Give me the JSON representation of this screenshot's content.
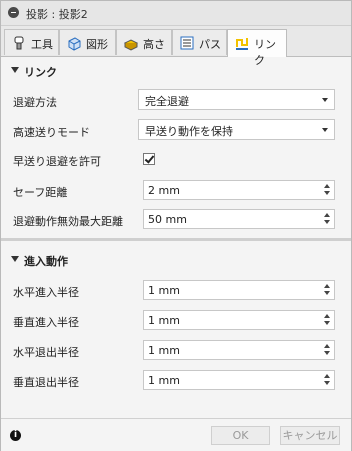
{
  "window": {
    "title": "投影 : 投影2"
  },
  "tabs": [
    {
      "label": "工具",
      "icon": "tool-icon"
    },
    {
      "label": "図形",
      "icon": "geometry-icon"
    },
    {
      "label": "高さ",
      "icon": "height-icon"
    },
    {
      "label": "パス",
      "icon": "passes-icon"
    },
    {
      "label": "リンク",
      "icon": "linking-icon",
      "active": true
    }
  ],
  "linking": {
    "title": "リンク",
    "retract_policy": {
      "label": "退避方法",
      "value": "完全退避"
    },
    "high_feed_mode": {
      "label": "高速送りモード",
      "value": "早送り動作を保持"
    },
    "allow_rapid_retract": {
      "label": "早送り退避を許可",
      "checked": true
    },
    "safe_distance": {
      "label": "セーフ距離",
      "value": "2 mm"
    },
    "max_stay_down": {
      "label": "退避動作無効最大距離",
      "value": "50 mm"
    }
  },
  "lead": {
    "title": "進入動作",
    "horizontal_lead_in": {
      "label": "水平進入半径",
      "value": "1 mm"
    },
    "vertical_lead_in": {
      "label": "垂直進入半径",
      "value": "1 mm"
    },
    "horizontal_lead_out": {
      "label": "水平退出半径",
      "value": "1 mm"
    },
    "vertical_lead_out": {
      "label": "垂直退出半径",
      "value": "1 mm"
    }
  },
  "footer": {
    "ok": "OK",
    "cancel": "キャンセル"
  },
  "colors": {
    "accent_tab_icon": "#f2c200",
    "tab_icon_blue": "#2a6ebf"
  }
}
